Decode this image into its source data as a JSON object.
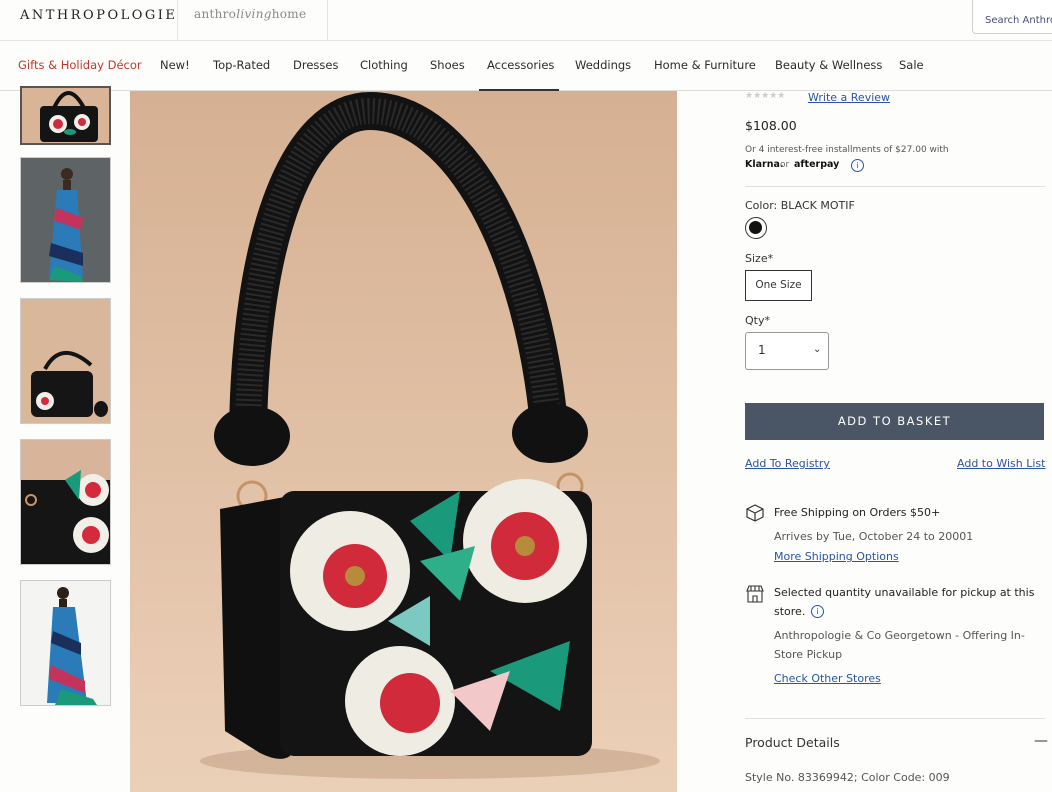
{
  "header": {
    "logo": "ANTHROPOLOGIE",
    "living_logo_a": "anthro",
    "living_logo_b": "living",
    "living_logo_c": "home",
    "search_placeholder": "Search Anthro"
  },
  "nav": {
    "items": [
      {
        "label": "Gifts & Holiday Décor",
        "color": "#c0392b"
      },
      {
        "label": "New!"
      },
      {
        "label": "Top-Rated"
      },
      {
        "label": "Dresses"
      },
      {
        "label": "Clothing"
      },
      {
        "label": "Shoes"
      },
      {
        "label": "Accessories",
        "active": true
      },
      {
        "label": "Weddings"
      },
      {
        "label": "Home & Furniture"
      },
      {
        "label": "Beauty & Wellness"
      },
      {
        "label": "Sale"
      }
    ]
  },
  "gallery": {
    "thumbnails": [
      "bag-front",
      "model-dress-1",
      "bag-side",
      "bag-detail",
      "model-dress-2"
    ],
    "selected_index": 0
  },
  "product": {
    "rating_stars": "★★★★★",
    "write_review": "Write a Review",
    "price": "$108.00",
    "installments": "Or 4 interest-free installments of $27.00 with",
    "klarna": "Klarna.",
    "or": "or",
    "afterpay": "afterpay",
    "color_label": "Color:",
    "color_value": "BLACK MOTIF",
    "swatch_color": "#111111",
    "size_label": "Size*",
    "size_value": "One Size",
    "qty_label": "Qty*",
    "qty_value": "1",
    "add_to_basket": "ADD TO BASKET",
    "add_to_registry": "Add To Registry",
    "add_to_wishlist": "Add to Wish List",
    "shipping_title": "Free Shipping on Orders $50+",
    "shipping_arrives": "Arrives by Tue, October 24 to 20001",
    "shipping_more": "More Shipping Options",
    "pickup_line1": "Selected quantity unavailable for pickup at this",
    "pickup_line2": "store.",
    "store_line1": "Anthropologie & Co Georgetown - Offering In-",
    "store_line2": "Store Pickup",
    "check_stores": "Check Other Stores",
    "details_title": "Product Details",
    "details_toggle": "—",
    "style_no": "Style No. 83369942; Color Code: 009"
  },
  "colors": {
    "accent_blue": "#2a55a3",
    "button_bg": "#4a5666",
    "sale_red": "#c0392b"
  }
}
